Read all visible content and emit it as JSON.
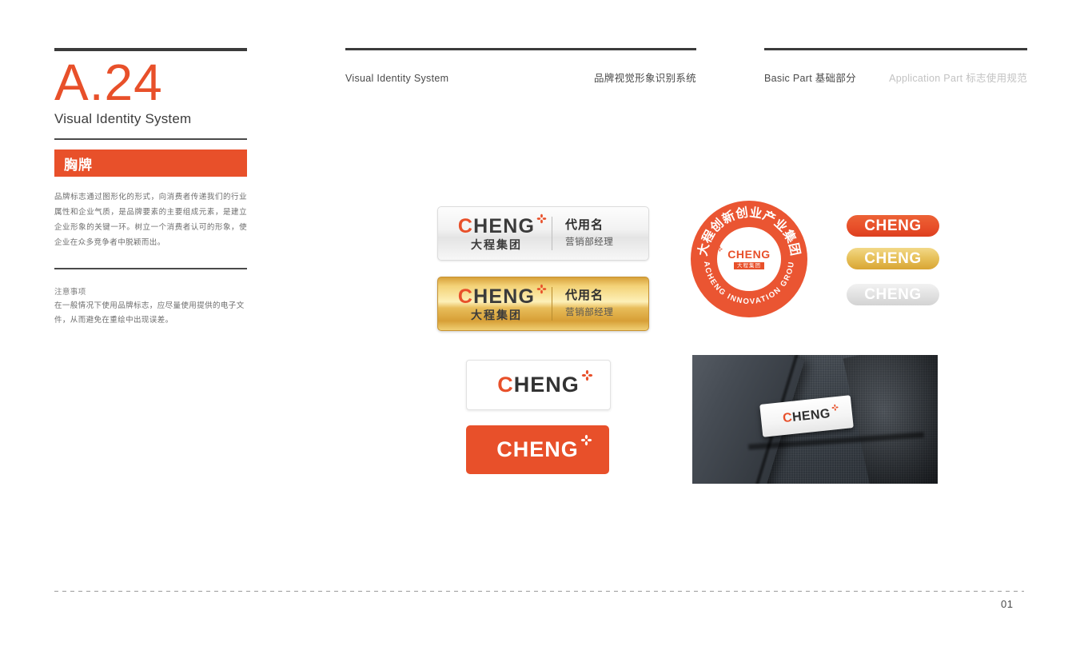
{
  "sidebar": {
    "code": "A.24",
    "subtitle": "Visual Identity System",
    "section_title": "胸牌",
    "body_copy": "品牌标志通过图形化的形式，向消费者传递我们的行业属性和企业气质，是品牌要素的主要组成元素，是建立企业形象的关键一环。树立一个消费者认可的形象，使企业在众多竞争者中脱颖而出。",
    "note_title": "注意事项",
    "note_body": "在一般情况下使用品牌标志，应尽量使用提供的电子文件，从而避免在重绘中出现误差。"
  },
  "header": {
    "center_left": "Visual Identity System",
    "center_right": "品牌视觉形象识别系统",
    "right_active": "Basic Part 基础部分",
    "right_inactive": "Application Part 标志使用规范"
  },
  "badges": {
    "silver": {
      "wordmark_c": "C",
      "wordmark_rest": "HENG",
      "cn_name": "大程集团",
      "person_name": "代用名",
      "person_title": "营销部经理"
    },
    "gold": {
      "wordmark_c": "C",
      "wordmark_rest": "HENG",
      "cn_name": "大程集团",
      "person_name": "代用名",
      "person_title": "营销部经理"
    },
    "white_card": {
      "wordmark_c": "C",
      "wordmark_rest": "HENG"
    },
    "orange_card": {
      "wordmark": "CHENG"
    },
    "photo_pin": {
      "wordmark_c": "C",
      "wordmark_rest": "HENG"
    }
  },
  "seal": {
    "arc_top": "大程创新创业产业集团",
    "arc_bottom": "DACHENG INNOVATION GROUP",
    "center_word": "CHENG",
    "center_cn": "大程集团"
  },
  "pills": [
    {
      "label": "CHENG",
      "variant": "orange"
    },
    {
      "label": "CHENG",
      "variant": "gold"
    },
    {
      "label": "CHENG",
      "variant": "silver"
    }
  ],
  "footer": {
    "page_number": "01"
  },
  "colors": {
    "brand_orange": "#e8502a",
    "dark_rule": "#3b3b3b",
    "body_text": "#6d6d6d",
    "dim_text": "#c2c2c2",
    "gold": "#e0b44f",
    "silver": "#e2e2e2"
  }
}
